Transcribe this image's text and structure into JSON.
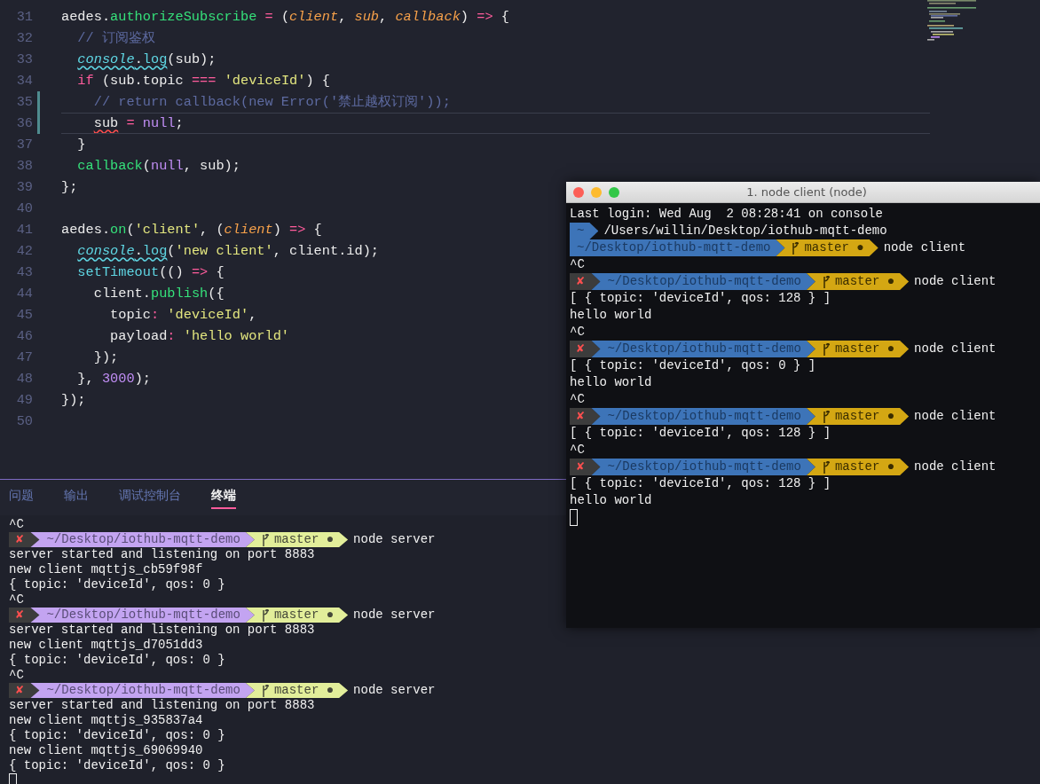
{
  "editor": {
    "lines": [
      {
        "num": "31",
        "tokens": [
          {
            "t": "aedes.",
            "kind": "plain"
          },
          {
            "t": "authorizeSubscribe",
            "kind": "fn"
          },
          {
            "t": " =",
            "kind": "op"
          },
          {
            "t": " (",
            "kind": "plain"
          },
          {
            "t": "client",
            "kind": "param"
          },
          {
            "t": ", ",
            "kind": "plain"
          },
          {
            "t": "sub",
            "kind": "param"
          },
          {
            "t": ", ",
            "kind": "plain"
          },
          {
            "t": "callback",
            "kind": "param"
          },
          {
            "t": ") ",
            "kind": "plain"
          },
          {
            "t": "=>",
            "kind": "op"
          },
          {
            "t": " {",
            "kind": "plain"
          }
        ]
      },
      {
        "num": "32",
        "tokens": [
          {
            "t": "  // 订阅鉴权",
            "kind": "comment"
          }
        ]
      },
      {
        "num": "33",
        "tokens": [
          {
            "t": "  console",
            "kind": "global",
            "warning": true
          },
          {
            "t": ".",
            "kind": "plain",
            "warning": true
          },
          {
            "t": "log",
            "kind": "builtin",
            "warning": true
          },
          {
            "t": "(sub);",
            "kind": "plain"
          }
        ]
      },
      {
        "num": "34",
        "tokens": [
          {
            "t": "  if",
            "kind": "op"
          },
          {
            "t": " (sub.topic ",
            "kind": "plain"
          },
          {
            "t": "===",
            "kind": "op"
          },
          {
            "t": " 'deviceId'",
            "kind": "string"
          },
          {
            "t": ") {",
            "kind": "plain"
          }
        ]
      },
      {
        "num": "35",
        "modified": true,
        "tokens": [
          {
            "t": "    // return callback(new Error('禁止越权订阅'));",
            "kind": "comment"
          }
        ]
      },
      {
        "num": "36",
        "modified": true,
        "current": true,
        "tokens": [
          {
            "t": "    sub",
            "kind": "plain",
            "error": true
          },
          {
            "t": " =",
            "kind": "op"
          },
          {
            "t": " null",
            "kind": "const"
          },
          {
            "t": ";",
            "kind": "plain"
          }
        ]
      },
      {
        "num": "37",
        "tokens": [
          {
            "t": "  }",
            "kind": "plain"
          }
        ]
      },
      {
        "num": "38",
        "tokens": [
          {
            "t": "  callback",
            "kind": "fn"
          },
          {
            "t": "(",
            "kind": "plain"
          },
          {
            "t": "null",
            "kind": "const"
          },
          {
            "t": ", sub);",
            "kind": "plain"
          }
        ]
      },
      {
        "num": "39",
        "tokens": [
          {
            "t": "};",
            "kind": "plain"
          }
        ]
      },
      {
        "num": "40"
      },
      {
        "num": "41",
        "tokens": [
          {
            "t": "aedes.",
            "kind": "plain"
          },
          {
            "t": "on",
            "kind": "fn"
          },
          {
            "t": "(",
            "kind": "plain"
          },
          {
            "t": "'client'",
            "kind": "string"
          },
          {
            "t": ", (",
            "kind": "plain"
          },
          {
            "t": "client",
            "kind": "param"
          },
          {
            "t": ") ",
            "kind": "plain"
          },
          {
            "t": "=>",
            "kind": "op"
          },
          {
            "t": " {",
            "kind": "plain"
          }
        ]
      },
      {
        "num": "42",
        "tokens": [
          {
            "t": "  console",
            "kind": "global",
            "warning": true
          },
          {
            "t": ".",
            "kind": "plain",
            "warning": true
          },
          {
            "t": "log",
            "kind": "builtin",
            "warning": true
          },
          {
            "t": "(",
            "kind": "plain"
          },
          {
            "t": "'new client'",
            "kind": "string"
          },
          {
            "t": ", client.id);",
            "kind": "plain"
          }
        ]
      },
      {
        "num": "43",
        "tokens": [
          {
            "t": "  setTimeout",
            "kind": "builtin"
          },
          {
            "t": "(() ",
            "kind": "plain"
          },
          {
            "t": "=>",
            "kind": "op"
          },
          {
            "t": " {",
            "kind": "plain"
          }
        ]
      },
      {
        "num": "44",
        "tokens": [
          {
            "t": "    client.",
            "kind": "plain"
          },
          {
            "t": "publish",
            "kind": "fn"
          },
          {
            "t": "({",
            "kind": "plain"
          }
        ]
      },
      {
        "num": "45",
        "tokens": [
          {
            "t": "      topic",
            "kind": "plain"
          },
          {
            "t": ":",
            "kind": "op"
          },
          {
            "t": " 'deviceId'",
            "kind": "string"
          },
          {
            "t": ",",
            "kind": "plain"
          }
        ]
      },
      {
        "num": "46",
        "tokens": [
          {
            "t": "      payload",
            "kind": "plain"
          },
          {
            "t": ":",
            "kind": "op"
          },
          {
            "t": " 'hello world'",
            "kind": "string"
          }
        ]
      },
      {
        "num": "47",
        "tokens": [
          {
            "t": "    });",
            "kind": "plain"
          }
        ]
      },
      {
        "num": "48",
        "tokens": [
          {
            "t": "  }, ",
            "kind": "plain"
          },
          {
            "t": "3000",
            "kind": "const"
          },
          {
            "t": ");",
            "kind": "plain"
          }
        ]
      },
      {
        "num": "49",
        "tokens": [
          {
            "t": "});",
            "kind": "plain"
          }
        ]
      },
      {
        "num": "50"
      }
    ]
  },
  "panel": {
    "tabs": [
      {
        "label": "问题",
        "selected": false
      },
      {
        "label": "输出",
        "selected": false
      },
      {
        "label": "调试控制台",
        "selected": false
      },
      {
        "label": "终端",
        "selected": true
      }
    ],
    "terminal": {
      "cursor": true,
      "lines": [
        {
          "kind": "text",
          "text": "^C"
        },
        {
          "kind": "prompt",
          "status": "✘",
          "path": "~/Desktop/iothub-mqtt-demo",
          "branch": "master ●",
          "command": "node server"
        },
        {
          "kind": "text",
          "text": "server started and listening on port 8883"
        },
        {
          "kind": "text",
          "text": "new client mqttjs_cb59f98f"
        },
        {
          "kind": "text",
          "text": "{ topic: 'deviceId', qos: 0 }"
        },
        {
          "kind": "text",
          "text": "^C"
        },
        {
          "kind": "prompt",
          "status": "✘",
          "path": "~/Desktop/iothub-mqtt-demo",
          "branch": "master ●",
          "command": "node server"
        },
        {
          "kind": "text",
          "text": "server started and listening on port 8883"
        },
        {
          "kind": "text",
          "text": "new client mqttjs_d7051dd3"
        },
        {
          "kind": "text",
          "text": "{ topic: 'deviceId', qos: 0 }"
        },
        {
          "kind": "text",
          "text": "^C"
        },
        {
          "kind": "prompt",
          "status": "✘",
          "path": "~/Desktop/iothub-mqtt-demo",
          "branch": "master ●",
          "command": "node server"
        },
        {
          "kind": "text",
          "text": "server started and listening on port 8883"
        },
        {
          "kind": "text",
          "text": "new client mqttjs_935837a4"
        },
        {
          "kind": "text",
          "text": "{ topic: 'deviceId', qos: 0 }"
        },
        {
          "kind": "text",
          "text": "new client mqttjs_69069940"
        },
        {
          "kind": "text",
          "text": "{ topic: 'deviceId', qos: 0 }"
        }
      ]
    }
  },
  "terminal_window": {
    "title": "1. node client (node)",
    "cursor": true,
    "lines": [
      {
        "kind": "text",
        "text": "Last login: Wed Aug  2 08:28:41 on console"
      },
      {
        "kind": "dir",
        "segment": "~",
        "text": "/Users/willin/Desktop/iothub-mqtt-demo"
      },
      {
        "kind": "prompt",
        "path": "~/Desktop/iothub-mqtt-demo",
        "branch": "master ●",
        "command": "node client"
      },
      {
        "kind": "text",
        "text": "^C"
      },
      {
        "kind": "prompt",
        "status": "✘",
        "path": "~/Desktop/iothub-mqtt-demo",
        "branch": "master ●",
        "command": "node client"
      },
      {
        "kind": "text",
        "text": "[ { topic: 'deviceId', qos: 128 } ]"
      },
      {
        "kind": "text",
        "text": "hello world"
      },
      {
        "kind": "text",
        "text": "^C"
      },
      {
        "kind": "prompt",
        "status": "✘",
        "path": "~/Desktop/iothub-mqtt-demo",
        "branch": "master ●",
        "command": "node client"
      },
      {
        "kind": "text",
        "text": "[ { topic: 'deviceId', qos: 0 } ]"
      },
      {
        "kind": "text",
        "text": "hello world"
      },
      {
        "kind": "text",
        "text": "^C"
      },
      {
        "kind": "prompt",
        "status": "✘",
        "path": "~/Desktop/iothub-mqtt-demo",
        "branch": "master ●",
        "command": "node client"
      },
      {
        "kind": "text",
        "text": "[ { topic: 'deviceId', qos: 128 } ]"
      },
      {
        "kind": "text",
        "text": "^C"
      },
      {
        "kind": "prompt",
        "status": "✘",
        "path": "~/Desktop/iothub-mqtt-demo",
        "branch": "master ●",
        "command": "node client"
      },
      {
        "kind": "text",
        "text": "[ { topic: 'deviceId', qos: 128 } ]"
      },
      {
        "kind": "text",
        "text": "hello world"
      }
    ]
  }
}
